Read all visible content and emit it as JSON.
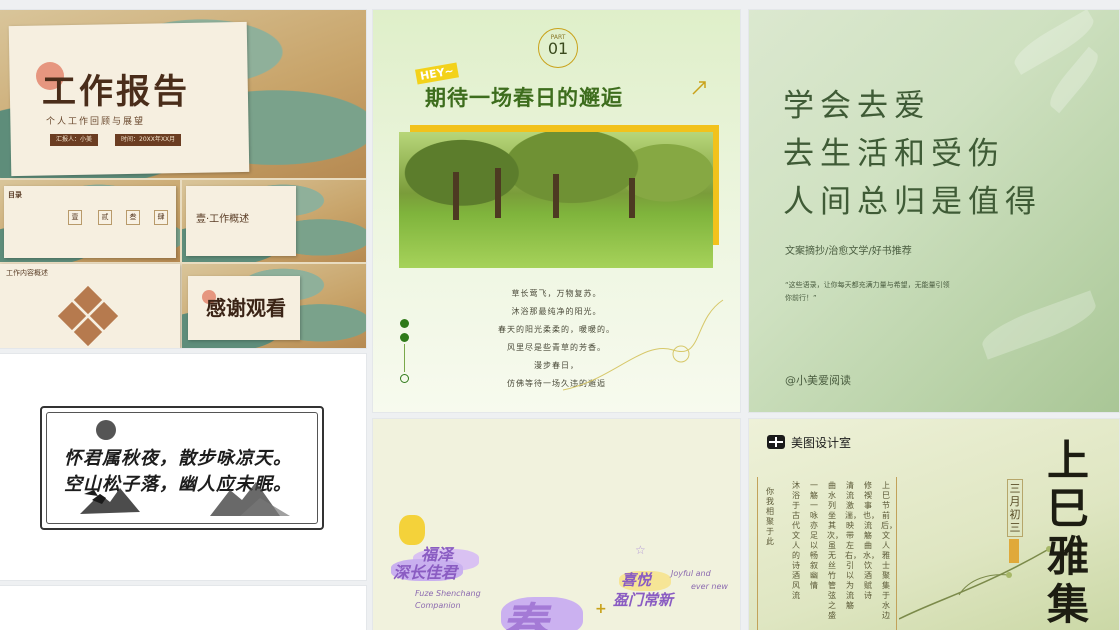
{
  "cards": {
    "report": {
      "title": "工作报告",
      "subtitle": "个人工作回顾与展望",
      "tag_name": "汇报人：小美",
      "tag_date": "时间：20XX年XX月",
      "contents_label": "目录",
      "items": [
        "壹",
        "贰",
        "叁",
        "肆"
      ],
      "overview": "壹·工作概述",
      "diamond_label": "工作内容概述",
      "thanks": "感谢观看"
    },
    "calligraphy": {
      "line1": "怀君属秋夜，散步咏凉天。",
      "line2": "空山松子落，幽人应未眠。"
    },
    "spring": {
      "part_label": "PART",
      "part_num": "01",
      "hey": "HEY~",
      "title": "期待一场春日的邂逅",
      "poem": [
        "草长莺飞，万物复苏。",
        "沐浴那最纯净的阳光。",
        "春天的阳光柔柔的，暖暖的。",
        "风里尽是些青草的芳香。",
        "漫步春日，",
        "仿佛等待一场久违的邂逅"
      ]
    },
    "love": {
      "lines": [
        "学会去爱",
        "去生活和受伤",
        "人间总归是值得"
      ],
      "tags": "文案摘抄/治愈文学/好书推荐",
      "quote1": "“这些语录，让你每天都充满力量与希望，无能量引领",
      "quote2": "你前行！”",
      "author": "@小美爱阅读"
    },
    "purple": {
      "text1": "福泽",
      "text2": "深长佳君",
      "en1": "Fuze Shenchang",
      "en2": "Companion",
      "text3": "喜悦",
      "text4": "盈门常新",
      "en3": "Joyful and",
      "en4": "ever new",
      "big": "春"
    },
    "shangsi": {
      "brand": "美图设计室",
      "title_chars": [
        "上",
        "巳",
        "雅",
        "集"
      ],
      "date": "三月初三",
      "cols": [
        "上巳节前后，文人雅士聚集于水边",
        "修禊事也，流觞曲水，饮酒赋诗",
        "清流激湍，映带左右，引以为流觞",
        "曲水列坐其次，虽无丝竹管弦之盛",
        "一觞一咏亦足以畅叙幽情",
        "沐浴于古代文人的诗酒风流",
        "你我相聚于此"
      ]
    }
  }
}
